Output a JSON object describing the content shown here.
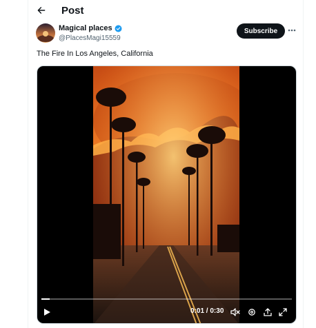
{
  "header": {
    "title": "Post",
    "back_icon": "arrow-left-icon"
  },
  "author": {
    "name": "Magical places",
    "handle": "@PlacesMagi15559",
    "verified": true,
    "avatar_icon": "avatar-image"
  },
  "actions": {
    "subscribe_label": "Subscribe",
    "more_icon": "more-horizontal-icon"
  },
  "tweet": {
    "text": "The Fire In Los Angeles, California"
  },
  "video": {
    "current_time": "0:01",
    "separator": "/",
    "duration": "0:30",
    "progress": 0.033,
    "controls": [
      "play-icon",
      "volume-muted-icon",
      "settings-icon",
      "share-icon",
      "fullscreen-icon"
    ]
  },
  "colors": {
    "accent": "#1d9bf0",
    "text": "#0f1419",
    "muted": "#536471",
    "subscribe_bg": "#0f1419"
  }
}
